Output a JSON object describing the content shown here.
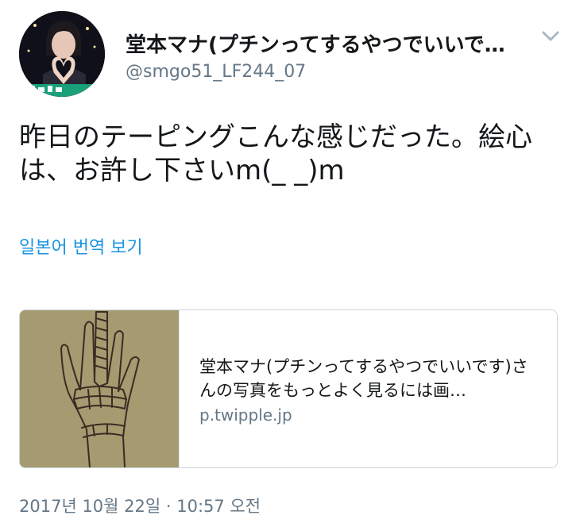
{
  "author": {
    "display_name": "堂本マナ(プチンってするやつでいいで…",
    "handle": "@smgo51_LF244_07",
    "avatar_icon": "user-avatar-photo"
  },
  "tweet": {
    "text": "昨日のテーピングこんな感じだった。絵心は、お許し下さいm(_ _)m",
    "translate_label": "일본어 번역 보기",
    "timestamp": "2017년 10월 22일 · 10:57 오전"
  },
  "card": {
    "image_icon": "taped-hand-drawing",
    "title": "堂本マナ(プチンってするやつでいいです)さんの写真をもっとよく見るには画…",
    "domain": "p.twipple.jp"
  },
  "colors": {
    "text_primary": "#14171a",
    "text_secondary": "#657786",
    "link": "#1b95e0",
    "border": "#ccd6dd"
  }
}
